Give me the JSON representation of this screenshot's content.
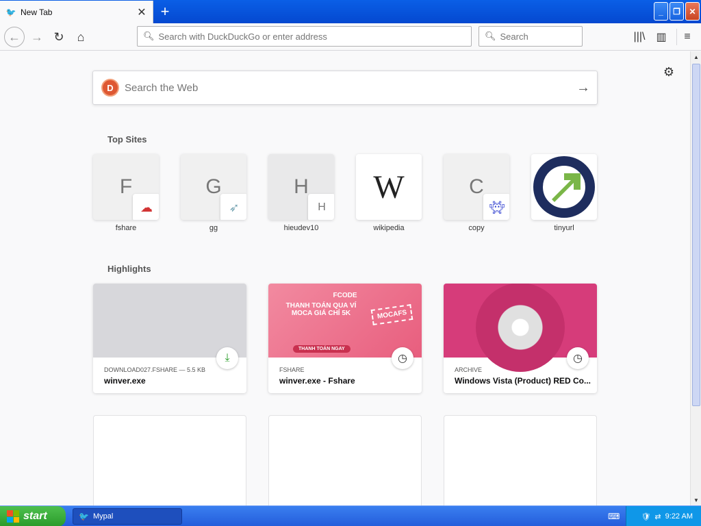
{
  "window": {
    "tab_title": "New Tab",
    "new_tab_symbol": "+"
  },
  "navbar": {
    "url_placeholder": "Search with DuckDuckGo or enter address",
    "search_placeholder": "Search"
  },
  "content": {
    "web_search_placeholder": "Search the Web",
    "top_sites_title": "Top Sites",
    "top_sites": [
      {
        "label": "fshare",
        "letter": "F"
      },
      {
        "label": "gg",
        "letter": "G"
      },
      {
        "label": "hieudev10",
        "letter": "H",
        "badge_letter": "H"
      },
      {
        "label": "wikipedia",
        "letter": "W"
      },
      {
        "label": "copy",
        "letter": "C"
      },
      {
        "label": "tinyurl",
        "letter": ""
      }
    ],
    "highlights_title": "Highlights",
    "highlights": [
      {
        "meta": "DOWNLOAD027.FSHARE — 5.5 KB",
        "title": "winver.exe"
      },
      {
        "meta": "FSHARE",
        "title": "winver.exe - Fshare",
        "promo_title": "FCODE",
        "promo_big": "THANH TOÁN QUA VÍ MOCA GIÁ CHỈ 5K",
        "promo_code": "MOCAFS",
        "promo_button": "THANH TOÁN NGAY"
      },
      {
        "meta": "ARCHIVE",
        "title": "Windows Vista (Product) RED Co..."
      }
    ]
  },
  "taskbar": {
    "start_label": "start",
    "task_label": "Mypal",
    "clock": "9:22 AM"
  },
  "colors": {
    "accent": "#0a5fe6",
    "download_green": "#2a9d2a"
  }
}
